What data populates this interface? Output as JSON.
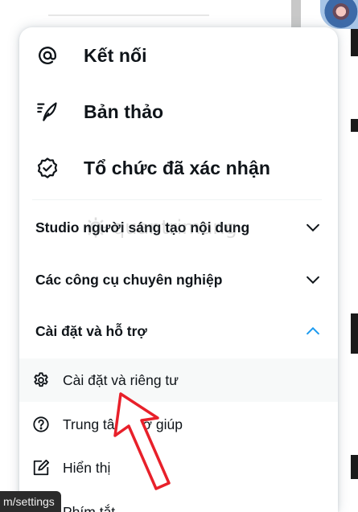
{
  "menu": {
    "top_items": [
      {
        "label": "Kết nối",
        "icon": "at-sign-icon"
      },
      {
        "label": "Bản thảo",
        "icon": "drafts-quill-icon"
      },
      {
        "label": "Tổ chức đã xác nhận",
        "icon": "verified-badge-icon"
      }
    ],
    "sections": [
      {
        "label": "Studio người sáng tạo nội dung",
        "expanded": false
      },
      {
        "label": "Các công cụ chuyên nghiệp",
        "expanded": false
      },
      {
        "label": "Cài đặt và hỗ trợ",
        "expanded": true
      }
    ],
    "sub_items": [
      {
        "label": "Cài đặt và riêng tư",
        "icon": "gear-icon"
      },
      {
        "label": "Trung tâm Trợ giúp",
        "icon": "help-circle-icon"
      },
      {
        "label": "Hiển thị",
        "icon": "display-edit-icon"
      },
      {
        "label": "Phím tắt",
        "icon": "keyboard-icon"
      }
    ]
  },
  "watermark": {
    "text": "quantrimang"
  },
  "status_url": "m/settings",
  "colors": {
    "accent": "#1d9bf0",
    "text": "#0f1419",
    "annotation_arrow": "#e8202a"
  }
}
